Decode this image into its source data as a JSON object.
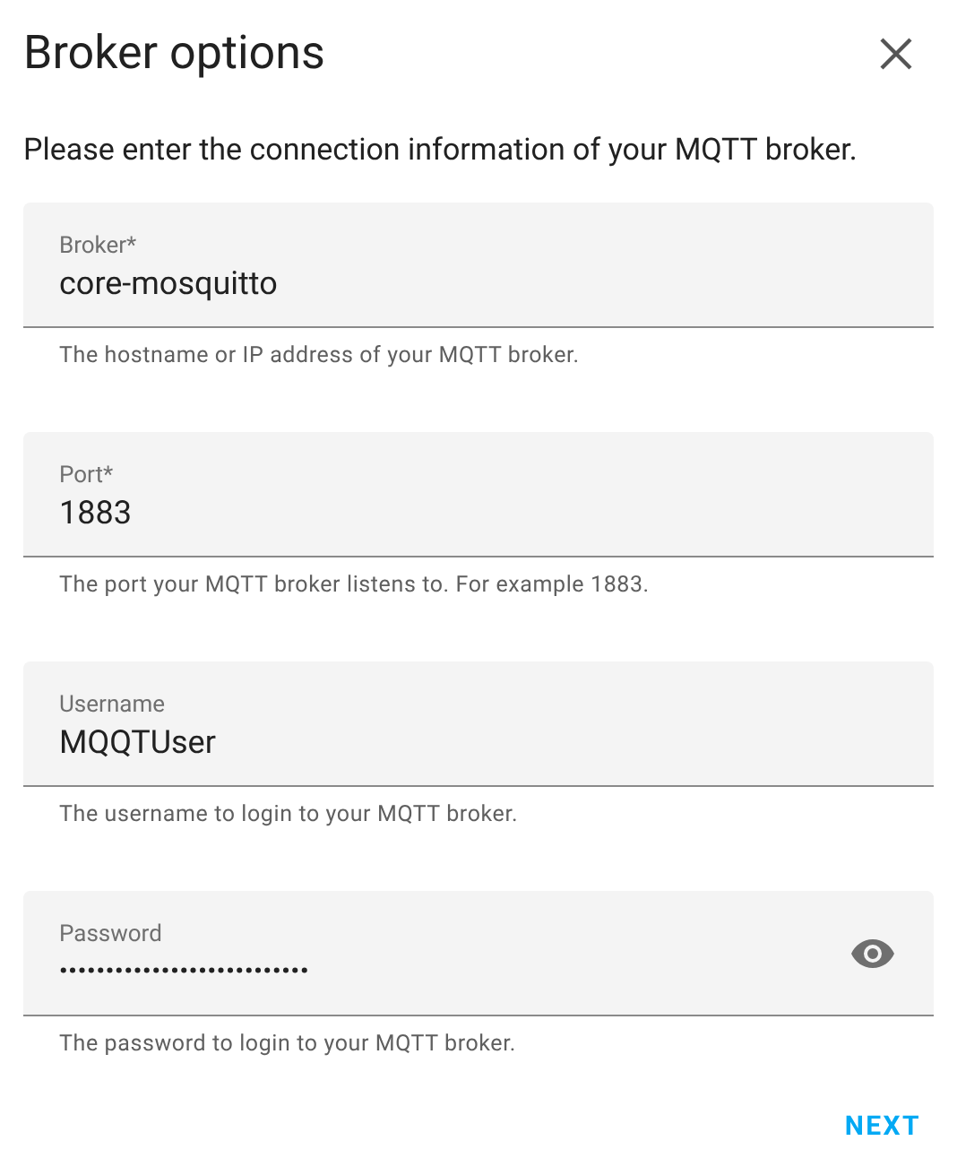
{
  "dialog": {
    "title": "Broker options",
    "description": "Please enter the connection information of your MQTT broker."
  },
  "fields": [
    {
      "kind": "text",
      "label": "Broker*",
      "value": "core-mosquitto",
      "helper": "The hostname or IP address of your MQTT broker."
    },
    {
      "kind": "text",
      "label": "Port*",
      "value": "1883",
      "helper": "The port your MQTT broker listens to. For example 1883."
    },
    {
      "kind": "text",
      "label": "Username",
      "value": "MQQTUser",
      "helper": "The username to login to your MQTT broker."
    },
    {
      "kind": "password",
      "label": "Password",
      "value": "•••••••••••••••••••••••••••",
      "helper": "The password to login to your MQTT broker."
    }
  ],
  "actions": [
    "NEXT"
  ]
}
